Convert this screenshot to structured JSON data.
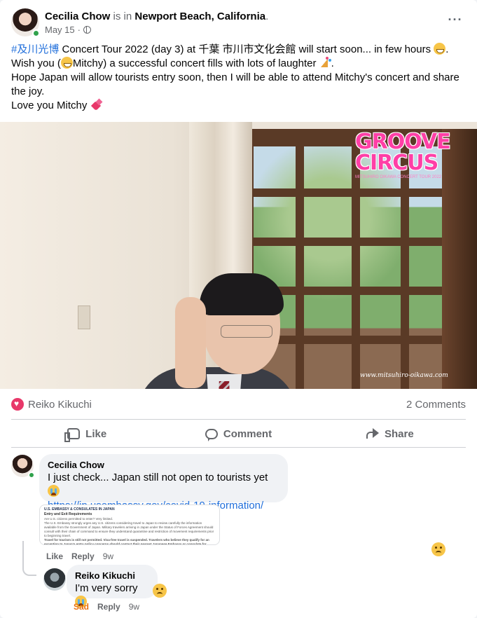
{
  "post": {
    "author": "Cecilia Chow",
    "is_in": "is in",
    "location": "Newport Beach, California",
    "location_suffix": ".",
    "date": "May 15",
    "date_sep": "·",
    "text": {
      "hashtag": "#及川光博",
      "line1_rest": " Concert Tour 2022 (day 3) at 千葉 市川市文化会館 will start soon... in few hours ",
      "line1_end": ".",
      "line2_a": "Wish you (",
      "line2_b": "Mitchy) a successful concert fills with lots of laughter ",
      "line2_end": ".",
      "line3": "Hope Japan will allow tourists entry soon, then I will be able to attend Mitchy's concert and share the joy.",
      "line4": "Love you Mitchy "
    }
  },
  "photo": {
    "brand_line1": "GROOVE",
    "brand_line2": "CIRCUS",
    "brand_tagline": "MITSUHIRO OIKAWA CONCERT TOUR 2022",
    "watermark": "www.mitsuhiro-oikawa.com"
  },
  "reactions": {
    "name": "Reiko Kikuchi",
    "comments_count": "2 Comments"
  },
  "actions": {
    "like": "Like",
    "comment": "Comment",
    "share": "Share"
  },
  "comments": [
    {
      "author": "Cecilia Chow",
      "text": "I just check... Japan still not open to tourists yet ",
      "link": "https://jp.usembassy.gov/covid-19-information/",
      "link_card": {
        "title": "U.S. EMBASSY & CONSULATES IN JAPAN",
        "heading": "Entry and Exit Requirements",
        "q": "Are U.S. citizens permitted to enter? Very limited.",
        "body1": "The U.S. Embassy strongly urges any U.S. citizens considering travel to Japan to review carefully the information available from the Government of Japan. Military travelers arriving in Japan under the Status of Forces Agreement should consult with their chain of command to ensure they understand quarantine and restriction of movement requirements prior to beginning travel.",
        "body2": "Travel for tourism is still not permitted. Visa-free travel is suspended. Travelers who believe they qualify for an exception to Japan's entry policy concerns should contact their nearest Japanese Embassy or consulate for information."
      },
      "like": "Like",
      "reply": "Reply",
      "time": "9w"
    },
    {
      "author": "Reiko Kikuchi",
      "text": "I'm very sorry",
      "reaction": "Sad",
      "reply": "Reply",
      "time": "9w"
    }
  ]
}
